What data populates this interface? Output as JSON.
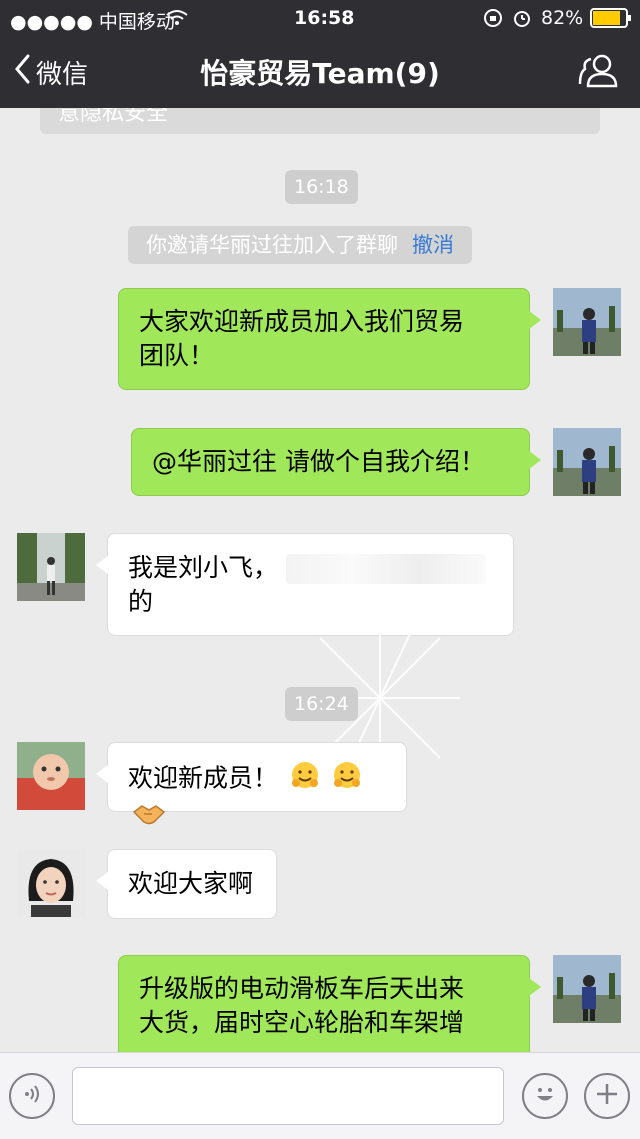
{
  "status_bar": {
    "carrier": "●●●●● 中国移动",
    "time": "16:58",
    "battery": "82%"
  },
  "nav": {
    "back_label": "微信",
    "title": "怡豪贸易Team(9)"
  },
  "chat": {
    "notice_cut": "意隐私安全",
    "time1": "16:18",
    "system_message": "你邀请华丽过往加入了群聊",
    "system_action": "撤消",
    "msg1_line1": "大家欢迎新成员加入我们贸易",
    "msg1_line2": "团队！",
    "msg2": "@华丽过往 请做个自我介绍！",
    "msg3_line1": "我是刘小飞，",
    "msg3_line2": "的",
    "time2": "16:24",
    "msg4": "欢迎新成员！",
    "msg5": "欢迎大家啊",
    "msg6_line1": "升级版的电动滑板车后天出来",
    "msg6_line2": "大货，届时空心轮胎和车架增"
  },
  "input": {
    "placeholder": ""
  },
  "icons": {
    "back": "chevron-left-icon",
    "group": "group-members-icon",
    "voice": "voice-icon",
    "emoji": "emoji-icon",
    "plus": "plus-icon"
  },
  "colors": {
    "bar": "#2e2e33",
    "my_bubble": "#a0e75a",
    "link": "#3a7bd5",
    "battery": "#ffcc00"
  }
}
